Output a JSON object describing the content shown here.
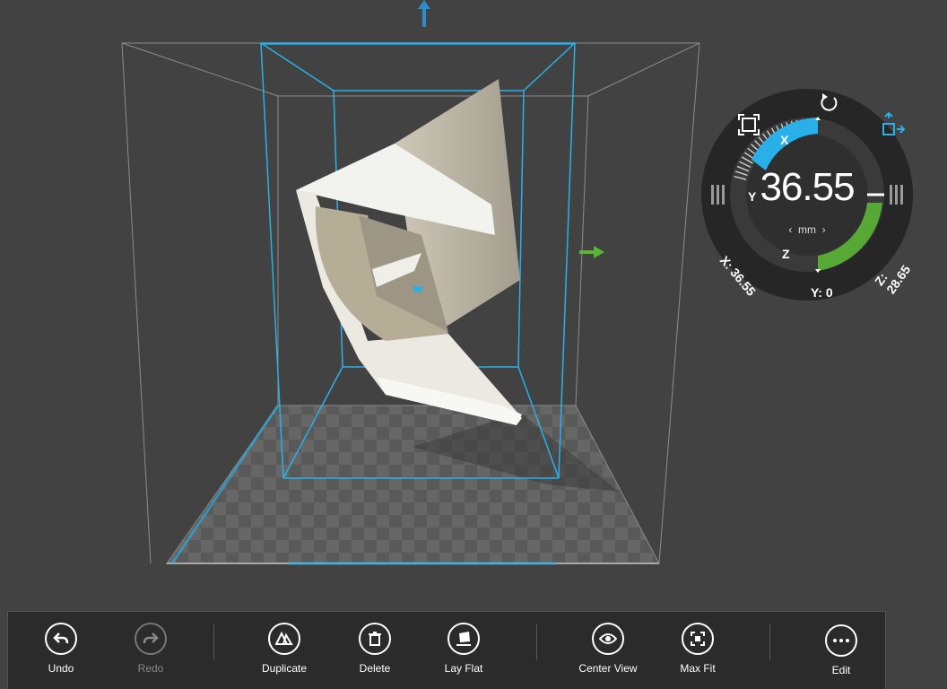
{
  "transform_dial": {
    "axis_labels": {
      "x": "X",
      "y": "Y",
      "z": "Z"
    },
    "value": "36.55",
    "unit": "mm",
    "readouts": {
      "x": "X: 36.55",
      "y": "Y: 0",
      "z": "Z: 28.65"
    },
    "active_axis": "X",
    "icons": [
      "rotate-icon",
      "move-icon",
      "scale-icon"
    ]
  },
  "toolbar": {
    "items": [
      {
        "label": "Undo",
        "icon": "undo-icon",
        "enabled": true
      },
      {
        "label": "Redo",
        "icon": "redo-icon",
        "enabled": false
      },
      {
        "label": "Duplicate",
        "icon": "duplicate-icon",
        "enabled": true
      },
      {
        "label": "Delete",
        "icon": "trash-icon",
        "enabled": true
      },
      {
        "label": "Lay Flat",
        "icon": "lay-flat-icon",
        "enabled": true
      },
      {
        "label": "Center View",
        "icon": "eye-icon",
        "enabled": true
      },
      {
        "label": "Max Fit",
        "icon": "max-fit-icon",
        "enabled": true
      },
      {
        "label": "Edit",
        "icon": "more-icon",
        "enabled": true
      }
    ]
  },
  "colors": {
    "background": "#424242",
    "selection_blue": "#2ab0e8",
    "accent_green": "#5bb534",
    "toolbar_bg": "#2b2b2b"
  }
}
